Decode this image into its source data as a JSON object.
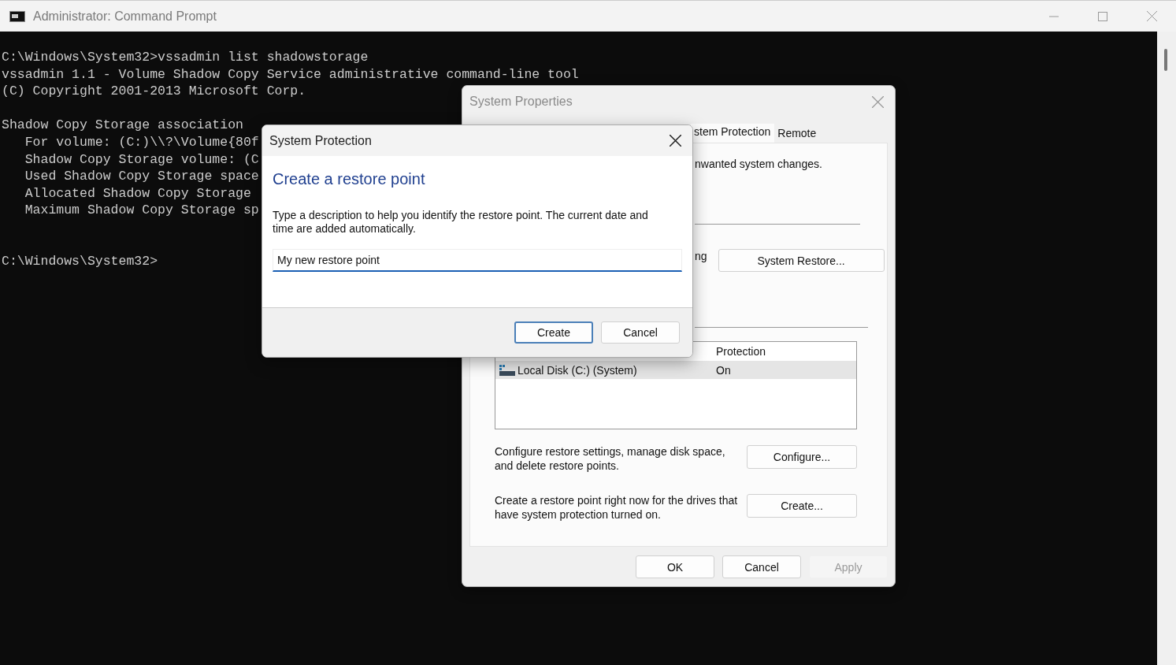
{
  "console_window": {
    "title": "Administrator: Command Prompt",
    "lines": [
      {
        "text": "C:\\Windows\\System32>vssadmin list shadowstorage",
        "kind": "line"
      },
      {
        "text": "vssadmin 1.1 - Volume Shadow Copy Service administrative command-line tool",
        "kind": "line"
      },
      {
        "text": "(C) Copyright 2001-2013 Microsoft Corp.",
        "kind": "line"
      },
      {
        "text": "Shadow Copy Storage association",
        "kind": "after_blank"
      },
      {
        "text": "   For volume: (C:)\\\\?\\Volume{80f",
        "kind": "line"
      },
      {
        "text": "   Shadow Copy Storage volume: (C",
        "kind": "line"
      },
      {
        "text": "   Used Shadow Copy Storage space",
        "kind": "line"
      },
      {
        "text": "   Allocated Shadow Copy Storage",
        "kind": "line"
      },
      {
        "text": "   Maximum Shadow Copy Storage sp",
        "kind": "line"
      },
      {
        "text": "C:\\Windows\\System32>",
        "kind": "after_two_blanks"
      }
    ]
  },
  "system_properties": {
    "title": "System Properties",
    "tabs": [
      {
        "label": "stem Protection",
        "selected": true
      },
      {
        "label": "Remote",
        "selected": false
      }
    ],
    "intro": "nwanted system changes.",
    "restore_label": "ng",
    "restore_button": "System Restore...",
    "table": {
      "columns": [
        "",
        "Protection"
      ],
      "rows": [
        {
          "cells": [
            "Local Disk (C:) (System)",
            "On"
          ],
          "selected": true
        }
      ]
    },
    "actions": [
      {
        "text": "Configure restore settings, manage disk space, and delete restore points.",
        "button": "Configure..."
      },
      {
        "text": "Create a restore point right now for the drives that have system protection turned on.",
        "button": "Create..."
      }
    ],
    "buttons": [
      {
        "label": "OK",
        "disabled": false
      },
      {
        "label": "Cancel",
        "disabled": false
      },
      {
        "label": "Apply",
        "disabled": true
      }
    ]
  },
  "dialog": {
    "title": "System Protection",
    "heading": "Create a restore point",
    "description": "Type a description to help you identify the restore point. The current date and time are added automatically.",
    "value": "My new restore point",
    "buttons": [
      {
        "label": "Create",
        "default": true
      },
      {
        "label": "Cancel",
        "default": false
      }
    ]
  }
}
